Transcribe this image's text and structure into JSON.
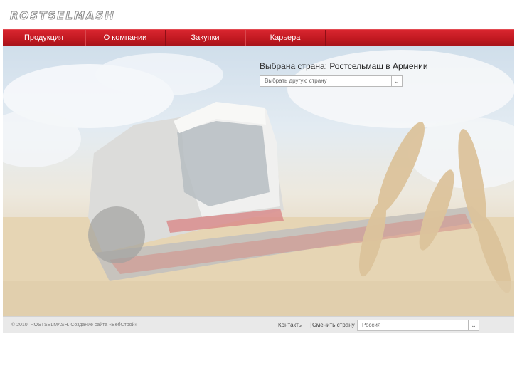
{
  "header": {
    "logo_text": "ROSTSELMASH"
  },
  "nav": {
    "items": [
      {
        "label": "Продукция"
      },
      {
        "label": "О компании"
      },
      {
        "label": "Закупки"
      },
      {
        "label": "Карьера"
      }
    ]
  },
  "country": {
    "prefix": "Выбрана страна:",
    "selected_link": "Ростсельмаш в Армении",
    "select_placeholder": "Выбрать другую страну"
  },
  "footer": {
    "copyright": "© 2010. ROSTSELMASH. Создание сайта «ВебСтрой»",
    "contacts_label": "Контакты",
    "separator": "|",
    "change_country_label": "Сменить страну",
    "country_select_value": "Россия"
  },
  "colors": {
    "nav_red": "#c11921",
    "footer_gray": "#e9e9e9"
  }
}
